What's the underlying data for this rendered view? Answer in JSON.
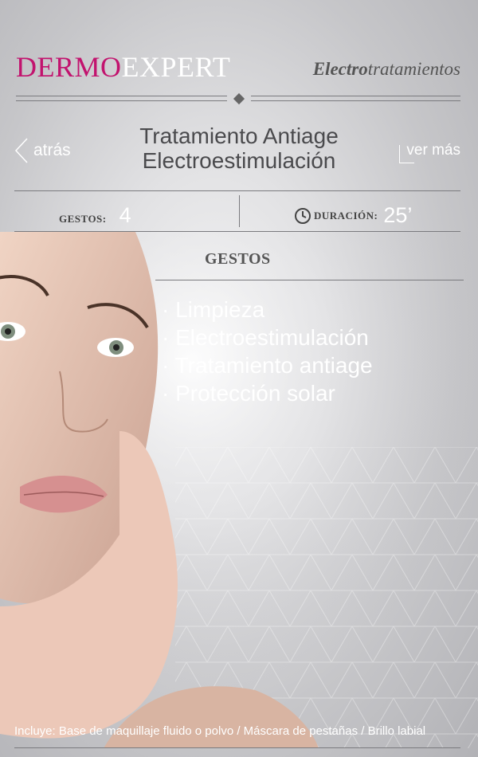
{
  "header": {
    "brand_part1": "DERMO",
    "brand_part2": "EXPERT",
    "section_bold": "Electro",
    "section_rest": "tratamientos"
  },
  "nav": {
    "back_label": "atrás",
    "more_label": "ver más"
  },
  "treatment": {
    "title_line1": "Tratamiento Antiage",
    "title_line2": "Electroestimulación"
  },
  "stats": {
    "gestures_label": "GESTOS:",
    "gestures_value": "4",
    "duration_label": "DURACIÓN:",
    "duration_value": "25’"
  },
  "gestos": {
    "heading": "GESTOS",
    "items": [
      "Limpieza",
      "Electroestimulación",
      "Tratamiento antiage",
      "Protección solar"
    ]
  },
  "footer": {
    "includes_text": "Incluye: Base de maquillaje fluido o polvo / Máscara de pestañas / Brillo labial"
  },
  "colors": {
    "brand_pink": "#c2136e",
    "text_dark": "#4a4a4d",
    "text_light": "#ffffff"
  }
}
